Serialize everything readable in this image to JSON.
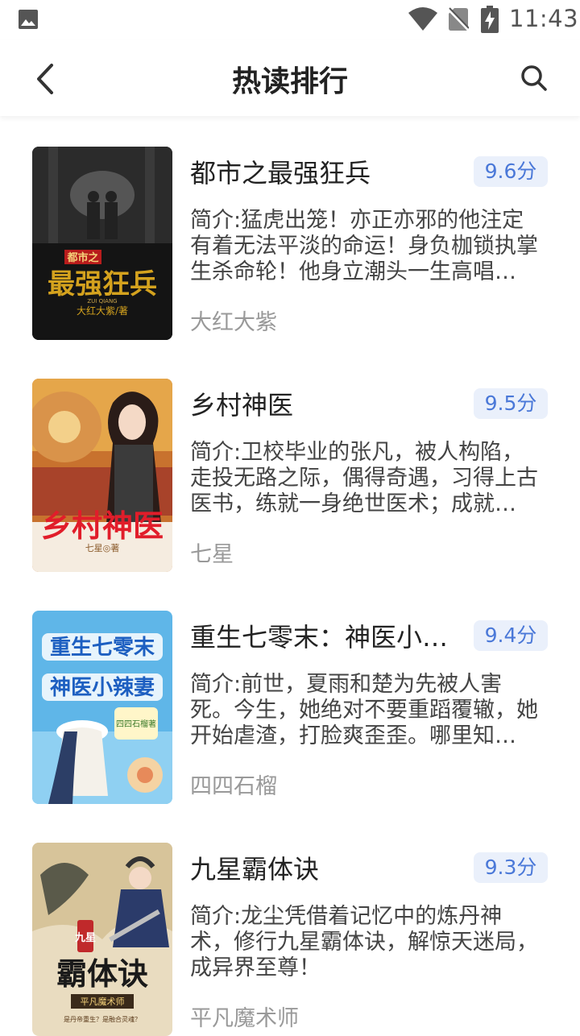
{
  "status_bar": {
    "time": "11:43",
    "icons": [
      "gallery-icon",
      "wifi-icon",
      "no-sim-icon",
      "battery-charging-icon"
    ]
  },
  "header": {
    "title": "热读排行",
    "back_icon": "chevron-left-icon",
    "search_icon": "search-icon"
  },
  "books": [
    {
      "title": "都市之最强狂兵",
      "score": "9.6分",
      "intro": "简介:猛虎出笼！亦正亦邪的他注定有着无法平淡的命运！身负枷锁执掌生杀命轮！他身立潮头一生高唱…",
      "author": "大红大紫",
      "cover": {
        "small": "都市之",
        "big": "最强狂兵",
        "pinyin": "ZUI QIANG",
        "byline": "大红大紫/著",
        "colors": {
          "bg": "#1a1a1a",
          "title": "#d4a21e",
          "accent": "#b81c1c"
        }
      }
    },
    {
      "title": "乡村神医",
      "score": "9.5分",
      "intro": "简介:卫校毕业的张凡，被人构陷，走投无路之际，偶得奇遇，习得上古医书，练就一身绝世医术；成就…",
      "author": "七星",
      "cover": {
        "big": "乡村神医",
        "byline": "七星◎著",
        "colors": {
          "bg": "#c8722e",
          "title": "#e11d2a",
          "accent": "#f4e3c2"
        }
      }
    },
    {
      "title": "重生七零末：神医小…",
      "score": "9.4分",
      "intro": "简介:前世，夏雨和楚为先被人害死。今生，她绝对不要重蹈覆辙，她开始虐渣，打脸爽歪歪。哪里知…",
      "author": "四四石榴",
      "cover": {
        "line1": "重生七零末",
        "line2": "神医小辣妻",
        "badge": "四四石榴著",
        "colors": {
          "bg": "#5fb6e8",
          "title": "#1d5fc1",
          "accent": "#ffffff"
        }
      }
    },
    {
      "title": "九星霸体诀",
      "score": "9.3分",
      "intro": "简介:龙尘凭借着记忆中的炼丹神术，修行九星霸体诀，解惊天迷局，成异界至尊！",
      "author": "平凡魔术师",
      "cover": {
        "small": "九星",
        "big": "霸体诀",
        "byline": "平凡魔术师",
        "tagline": "是丹帝重生？是融合灵魂？",
        "colors": {
          "bg": "#e9dcc0",
          "title": "#1a1a1a",
          "accent": "#c0292b"
        }
      }
    }
  ]
}
